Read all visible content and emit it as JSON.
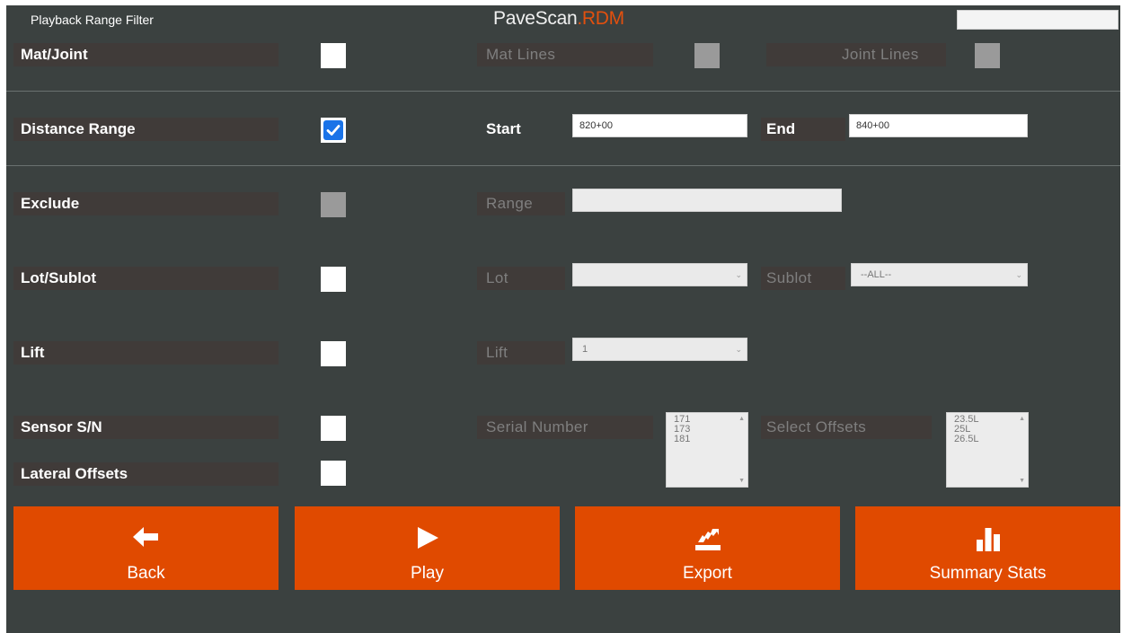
{
  "header": {
    "window_title": "Playback Range Filter",
    "logo_pave": "PaveScan",
    "logo_dot": ".",
    "logo_rdm": "RDM",
    "search_value": ""
  },
  "rows": {
    "mat_joint": {
      "label": "Mat/Joint",
      "checked": false,
      "mat_lines_label": "Mat Lines",
      "joint_lines_label": "Joint Lines"
    },
    "distance_range": {
      "label": "Distance Range",
      "checked": true,
      "start_label": "Start",
      "start_value": "820+00",
      "end_label": "End",
      "end_value": "840+00"
    },
    "exclude": {
      "label": "Exclude",
      "range_label": "Range",
      "range_value": ""
    },
    "lot_sublot": {
      "label": "Lot/Sublot",
      "lot_label": "Lot",
      "lot_value": "",
      "sublot_label": "Sublot",
      "sublot_value": "--ALL--"
    },
    "lift": {
      "label": "Lift",
      "lift_label": "Lift",
      "lift_value": "1"
    },
    "sensor_sn": {
      "label": "Sensor S/N",
      "serial_label": "Serial Number",
      "serials": [
        "171",
        "173",
        "181"
      ],
      "offsets_label": "Select Offsets",
      "offsets": [
        "23.5L",
        "25L",
        "26.5L"
      ]
    },
    "lateral_offsets": {
      "label": "Lateral Offsets"
    }
  },
  "buttons": {
    "back": {
      "label": "Back",
      "icon": "arrow-left-icon"
    },
    "play": {
      "label": "Play",
      "icon": "play-icon"
    },
    "export": {
      "label": "Export",
      "icon": "export-icon"
    },
    "summary": {
      "label": "Summary Stats",
      "icon": "bar-chart-icon"
    }
  },
  "colors": {
    "background": "#3b4140",
    "accent": "#e04a00",
    "checkbox_checked": "#1a73e8"
  }
}
